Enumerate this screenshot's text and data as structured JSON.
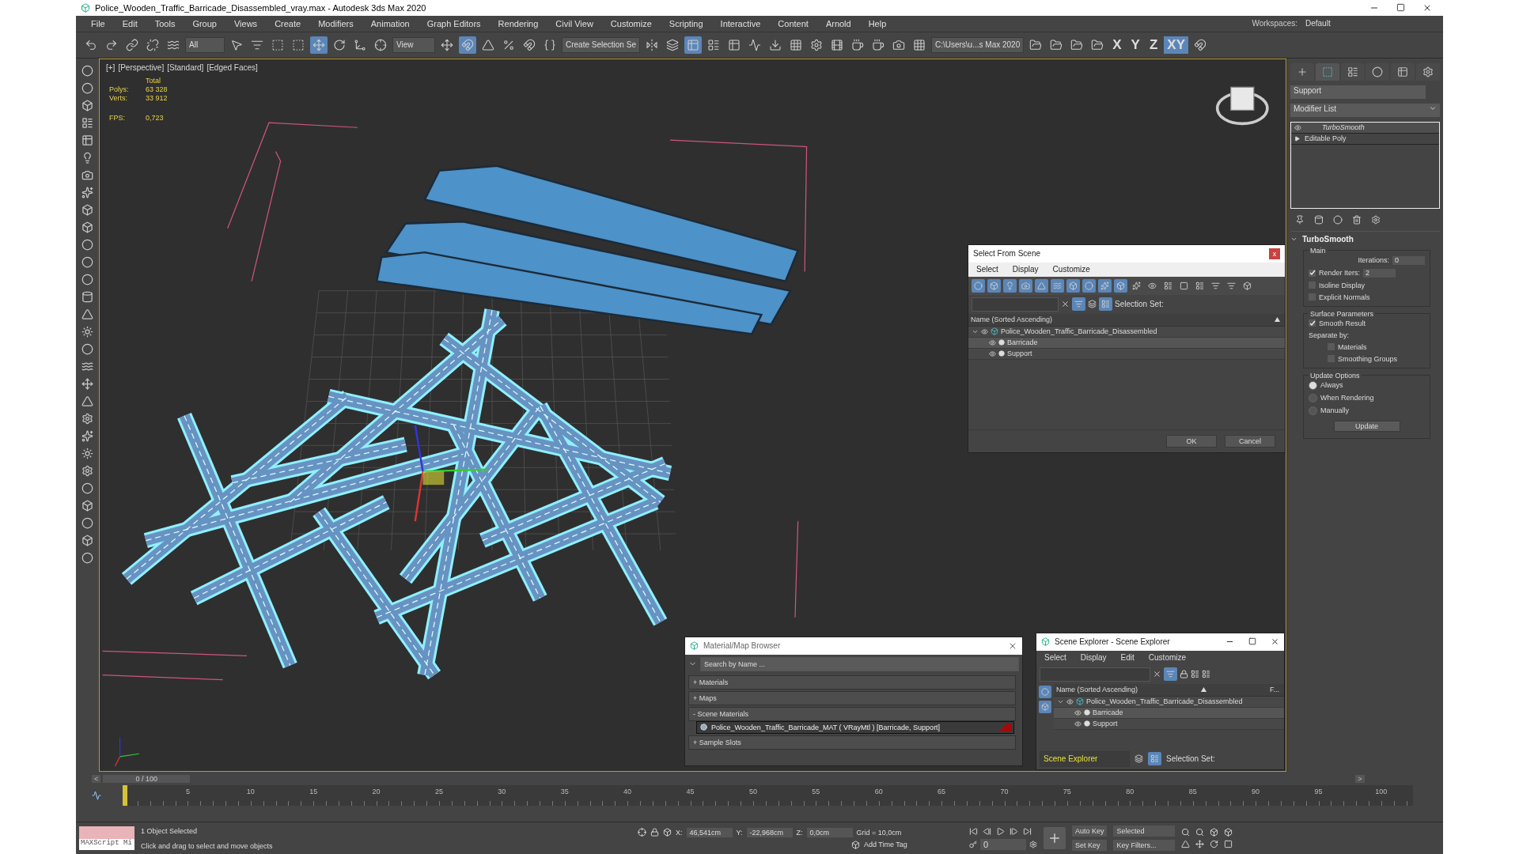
{
  "window": {
    "title": "Police_Wooden_Traffic_Barricade_Disassembled_vray.max - Autodesk 3ds Max 2020"
  },
  "menu": [
    "File",
    "Edit",
    "Tools",
    "Group",
    "Views",
    "Create",
    "Modifiers",
    "Animation",
    "Graph Editors",
    "Rendering",
    "Civil View",
    "Customize",
    "Scripting",
    "Interactive",
    "Content",
    "Arnold",
    "Help"
  ],
  "workspace": {
    "label": "Workspaces:",
    "value": "Default"
  },
  "toolbar": {
    "filter": "All",
    "coord_system": "View",
    "selection_set": "Create Selection Se",
    "project_path": "C:\\Users\\u...s Max 2020",
    "axes": [
      {
        "label": "X",
        "selected": false
      },
      {
        "label": "Y",
        "selected": false
      },
      {
        "label": "Z",
        "selected": false
      },
      {
        "label": "XY",
        "selected": true
      }
    ]
  },
  "viewport": {
    "labels": [
      "[+]",
      "[Perspective]",
      "[Standard]",
      "[Edged Faces]"
    ],
    "stats": {
      "header": "Total",
      "rows": [
        {
          "label": "Polys:",
          "value": "63 328"
        },
        {
          "label": "Verts:",
          "value": "33 912"
        }
      ],
      "fps_label": "FPS:",
      "fps": "0,723"
    }
  },
  "command_panel": {
    "tabs": [
      {
        "kind": "create",
        "selected": false
      },
      {
        "kind": "modify",
        "selected": true
      },
      {
        "kind": "hierarchy",
        "selected": false
      },
      {
        "kind": "motion",
        "selected": false
      },
      {
        "kind": "display",
        "selected": false
      },
      {
        "kind": "utilities",
        "selected": false
      }
    ],
    "object_name": "Support",
    "modifier_list": "Modifier List",
    "stack": [
      {
        "label": "TurboSmooth",
        "kind": "modifier"
      },
      {
        "label": "Editable Poly",
        "kind": "base"
      }
    ],
    "rollout": {
      "title": "TurboSmooth",
      "expanded": true,
      "groups": [
        {
          "title": "Main",
          "items": [
            {
              "kind": "spinner",
              "label": "Iterations:",
              "value": "0"
            },
            {
              "kind": "check_spinner",
              "label": "Render Iters:",
              "checked": true,
              "value": "2"
            },
            {
              "kind": "checkbox",
              "label": "Isoline Display",
              "checked": false
            },
            {
              "kind": "checkbox",
              "label": "Explicit Normals",
              "checked": false
            }
          ]
        },
        {
          "title": "Surface Parameters",
          "items": [
            {
              "kind": "checkbox",
              "label": "Smooth Result",
              "checked": true
            },
            {
              "kind": "text",
              "label": "Separate by:",
              "children": [
                {
                  "kind": "checkbox",
                  "label": "Materials",
                  "checked": false
                },
                {
                  "kind": "checkbox",
                  "label": "Smoothing Groups",
                  "checked": false
                }
              ]
            }
          ]
        },
        {
          "title": "Update Options",
          "items": [
            {
              "kind": "radio",
              "label": "Always",
              "selected": true
            },
            {
              "kind": "radio",
              "label": "When Rendering",
              "selected": false
            },
            {
              "kind": "radio",
              "label": "Manually",
              "selected": false
            },
            {
              "kind": "button",
              "label": "Update"
            }
          ]
        }
      ]
    }
  },
  "select_dialog": {
    "title": "Select From Scene",
    "close": "x",
    "menu": [
      "Select",
      "Display",
      "Customize"
    ],
    "selection_set": "Selection Set:",
    "column": "Name (Sorted Ascending)",
    "tree": [
      {
        "name": "Police_Wooden_Traffic_Barricade_Disassembled",
        "expanded": true,
        "selected": false,
        "children": [
          {
            "name": "Barricade",
            "selected": true
          },
          {
            "name": "Support",
            "selected": false
          }
        ]
      }
    ],
    "buttons": [
      "OK",
      "Cancel"
    ]
  },
  "material_browser": {
    "title": "Material/Map Browser",
    "placeholder": "Search by Name ...",
    "groups": [
      {
        "label": "+ Materials"
      },
      {
        "label": "+ Maps"
      },
      {
        "label": "- Scene Materials",
        "items": [
          "Police_Wooden_Traffic_Barricade_MAT ( VRayMtl ) [Barricade, Support]"
        ]
      },
      {
        "label": "+ Sample Slots"
      }
    ]
  },
  "scene_explorer": {
    "title": "Scene Explorer - Scene Explorer",
    "menu": [
      "Select",
      "Display",
      "Edit",
      "Customize"
    ],
    "column": "Name (Sorted Ascending)",
    "column_2": "F...",
    "tree": [
      {
        "name": "Police_Wooden_Traffic_Barricade_Disassembled",
        "expanded": true,
        "selected": false,
        "children": [
          {
            "name": "Barricade",
            "selected": true
          },
          {
            "name": "Support",
            "selected": false
          }
        ]
      }
    ],
    "explorer_name": "Scene Explorer",
    "selection_set": "Selection Set:"
  },
  "timeline": {
    "prev": "<",
    "position": "0 / 100",
    "level": 0,
    "next": ">",
    "ticks": [
      "5",
      "10",
      "15",
      "20",
      "25",
      "30",
      "35",
      "40",
      "45",
      "50",
      "55",
      "60",
      "65",
      "70",
      "75",
      "80",
      "85",
      "90",
      "95",
      "100"
    ]
  },
  "status_bar": {
    "listener": "MAXScript Mi",
    "selection": "1 Object Selected",
    "prompt": "Click and drag to select and move objects",
    "coords": [
      {
        "label": "X:",
        "value": "46,541cm"
      },
      {
        "label": "Y:",
        "value": "-22,968cm"
      },
      {
        "label": "Z:",
        "value": "0,0cm"
      }
    ],
    "grid": "Grid = 10,0cm",
    "time_tag": "Add Time Tag",
    "frame": "0",
    "auto_key": "Auto Key",
    "key_mode": "Selected",
    "set_key": "Set Key",
    "key_filters": "Key Filters..."
  }
}
